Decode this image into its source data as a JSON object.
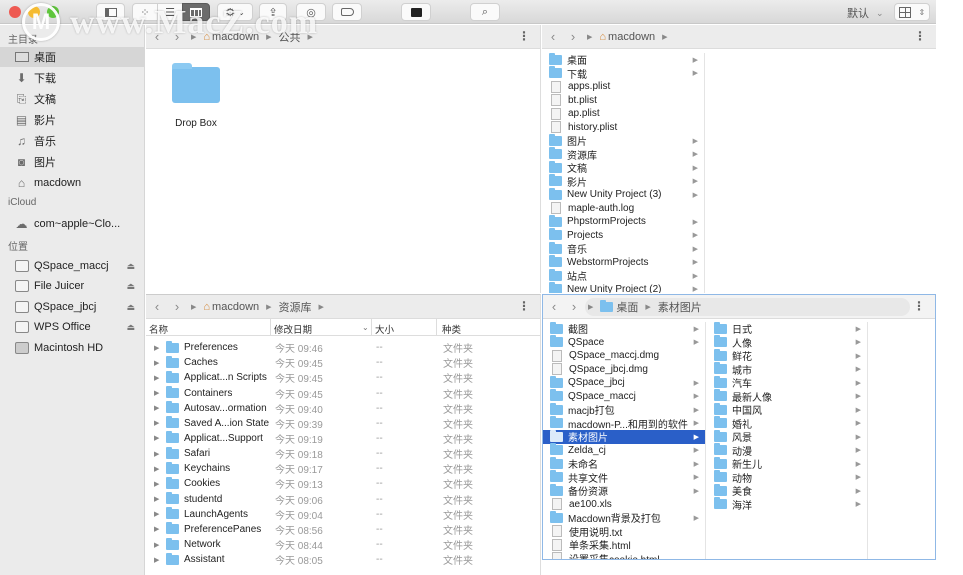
{
  "toolbar": {
    "view_mode_label": "默认",
    "buttons": [
      "sidebar-toggle",
      "icon-view",
      "list-view",
      "column-view",
      "action-menu",
      "share",
      "airdrop",
      "tags",
      "terminal",
      "search"
    ]
  },
  "sidebar": {
    "sections": [
      {
        "title": "主目录",
        "items": [
          {
            "label": "桌面",
            "icon": "desktop-icon",
            "selected": true
          },
          {
            "label": "下载",
            "icon": "download-icon"
          },
          {
            "label": "文稿",
            "icon": "documents-icon"
          },
          {
            "label": "影片",
            "icon": "movies-icon"
          },
          {
            "label": "音乐",
            "icon": "music-icon"
          },
          {
            "label": "图片",
            "icon": "pictures-icon"
          },
          {
            "label": "macdown",
            "icon": "home-icon"
          }
        ]
      },
      {
        "title": "iCloud",
        "items": [
          {
            "label": "com~apple~Clo...",
            "icon": "cloud-icon"
          }
        ]
      },
      {
        "title": "位置",
        "items": [
          {
            "label": "QSpace_maccj",
            "icon": "disk-icon",
            "eject": true
          },
          {
            "label": "File Juicer",
            "icon": "disk-icon",
            "eject": true
          },
          {
            "label": "QSpace_jbcj",
            "icon": "disk-icon",
            "eject": true
          },
          {
            "label": "WPS Office",
            "icon": "disk-icon",
            "eject": true
          },
          {
            "label": "Macintosh HD",
            "icon": "harddrive-icon"
          }
        ]
      }
    ]
  },
  "pane_top_left": {
    "path": [
      "macdown",
      "公共"
    ],
    "items": [
      {
        "name": "Drop Box",
        "type": "folder"
      }
    ]
  },
  "pane_top_right": {
    "path": [
      "macdown"
    ],
    "items": [
      {
        "name": "桌面",
        "type": "folder",
        "has_children": true
      },
      {
        "name": "下载",
        "type": "folder",
        "has_children": true
      },
      {
        "name": "apps.plist",
        "type": "file"
      },
      {
        "name": "bt.plist",
        "type": "file"
      },
      {
        "name": "ap.plist",
        "type": "file"
      },
      {
        "name": "history.plist",
        "type": "file"
      },
      {
        "name": "图片",
        "type": "folder",
        "has_children": true
      },
      {
        "name": "资源库",
        "type": "folder",
        "has_children": true
      },
      {
        "name": "文稿",
        "type": "folder",
        "has_children": true
      },
      {
        "name": "影片",
        "type": "folder",
        "has_children": true
      },
      {
        "name": "New Unity Project (3)",
        "type": "folder",
        "has_children": true
      },
      {
        "name": "maple-auth.log",
        "type": "file"
      },
      {
        "name": "PhpstormProjects",
        "type": "folder",
        "has_children": true
      },
      {
        "name": "Projects",
        "type": "folder",
        "has_children": true
      },
      {
        "name": "音乐",
        "type": "folder",
        "has_children": true
      },
      {
        "name": "WebstormProjects",
        "type": "folder",
        "has_children": true
      },
      {
        "name": "站点",
        "type": "folder",
        "has_children": true
      },
      {
        "name": "New Unity Project (2)",
        "type": "folder",
        "has_children": true
      }
    ]
  },
  "pane_bottom_left": {
    "path": [
      "macdown",
      "资源库"
    ],
    "columns": {
      "name": "名称",
      "date": "修改日期",
      "size": "大小",
      "kind": "种类"
    },
    "rows": [
      {
        "name": "Preferences",
        "date": "今天 09:46",
        "size": "--",
        "kind": "文件夹"
      },
      {
        "name": "Caches",
        "date": "今天 09:45",
        "size": "--",
        "kind": "文件夹"
      },
      {
        "name": "Applicat...n Scripts",
        "date": "今天 09:45",
        "size": "--",
        "kind": "文件夹"
      },
      {
        "name": "Containers",
        "date": "今天 09:45",
        "size": "--",
        "kind": "文件夹"
      },
      {
        "name": "Autosav...ormation",
        "date": "今天 09:40",
        "size": "--",
        "kind": "文件夹"
      },
      {
        "name": "Saved A...ion State",
        "date": "今天 09:39",
        "size": "--",
        "kind": "文件夹"
      },
      {
        "name": "Applicat...Support",
        "date": "今天 09:19",
        "size": "--",
        "kind": "文件夹"
      },
      {
        "name": "Safari",
        "date": "今天 09:18",
        "size": "--",
        "kind": "文件夹"
      },
      {
        "name": "Keychains",
        "date": "今天 09:17",
        "size": "--",
        "kind": "文件夹"
      },
      {
        "name": "Cookies",
        "date": "今天 09:13",
        "size": "--",
        "kind": "文件夹"
      },
      {
        "name": "studentd",
        "date": "今天 09:06",
        "size": "--",
        "kind": "文件夹"
      },
      {
        "name": "LaunchAgents",
        "date": "今天 09:04",
        "size": "--",
        "kind": "文件夹"
      },
      {
        "name": "PreferencePanes",
        "date": "今天 08:56",
        "size": "--",
        "kind": "文件夹"
      },
      {
        "name": "Network",
        "date": "今天 08:44",
        "size": "--",
        "kind": "文件夹"
      },
      {
        "name": "Assistant",
        "date": "今天 08:05",
        "size": "--",
        "kind": "文件夹"
      }
    ]
  },
  "pane_bottom_right": {
    "path": [
      "桌面",
      "素材图片"
    ],
    "column1": [
      {
        "name": "截图",
        "type": "folder",
        "has_children": true
      },
      {
        "name": "QSpace",
        "type": "folder",
        "has_children": true
      },
      {
        "name": "QSpace_maccj.dmg",
        "type": "file"
      },
      {
        "name": "QSpace_jbcj.dmg",
        "type": "file"
      },
      {
        "name": "QSpace_jbcj",
        "type": "folder",
        "has_children": true
      },
      {
        "name": "QSpace_maccj",
        "type": "folder",
        "has_children": true
      },
      {
        "name": "macjb打包",
        "type": "folder",
        "has_children": true
      },
      {
        "name": "macdown-P...和用到的软件",
        "type": "folder",
        "has_children": true
      },
      {
        "name": "素材图片",
        "type": "folder",
        "has_children": true,
        "selected": true
      },
      {
        "name": "Zelda_cj",
        "type": "folder",
        "has_children": true
      },
      {
        "name": "未命名",
        "type": "folder",
        "has_children": true
      },
      {
        "name": "共享文件",
        "type": "folder",
        "has_children": true
      },
      {
        "name": "备份资源",
        "type": "folder",
        "has_children": true
      },
      {
        "name": "ae100.xls",
        "type": "file"
      },
      {
        "name": "Macdown背景及打包",
        "type": "folder",
        "has_children": true
      },
      {
        "name": "使用说明.txt",
        "type": "file"
      },
      {
        "name": "单条采集.html",
        "type": "file"
      },
      {
        "name": "设置采集cookie.html",
        "type": "file"
      }
    ],
    "column2": [
      {
        "name": "日式",
        "type": "folder",
        "has_children": true
      },
      {
        "name": "人像",
        "type": "folder",
        "has_children": true
      },
      {
        "name": "鲜花",
        "type": "folder",
        "has_children": true
      },
      {
        "name": "城市",
        "type": "folder",
        "has_children": true
      },
      {
        "name": "汽车",
        "type": "folder",
        "has_children": true
      },
      {
        "name": "最新人像",
        "type": "folder",
        "has_children": true
      },
      {
        "name": "中国风",
        "type": "folder",
        "has_children": true
      },
      {
        "name": "婚礼",
        "type": "folder",
        "has_children": true
      },
      {
        "name": "风景",
        "type": "folder",
        "has_children": true
      },
      {
        "name": "动漫",
        "type": "folder",
        "has_children": true
      },
      {
        "name": "新生儿",
        "type": "folder",
        "has_children": true
      },
      {
        "name": "动物",
        "type": "folder",
        "has_children": true
      },
      {
        "name": "美食",
        "type": "folder",
        "has_children": true
      },
      {
        "name": "海洋",
        "type": "folder",
        "has_children": true
      }
    ]
  },
  "watermark": {
    "text": "www.MacZ.com",
    "logo": "M"
  },
  "colors": {
    "selection": "#2a5fc8",
    "folder": "#7cc0ee",
    "sidebar_bg": "#ebebeb",
    "focus_border": "#8fb8e6"
  }
}
